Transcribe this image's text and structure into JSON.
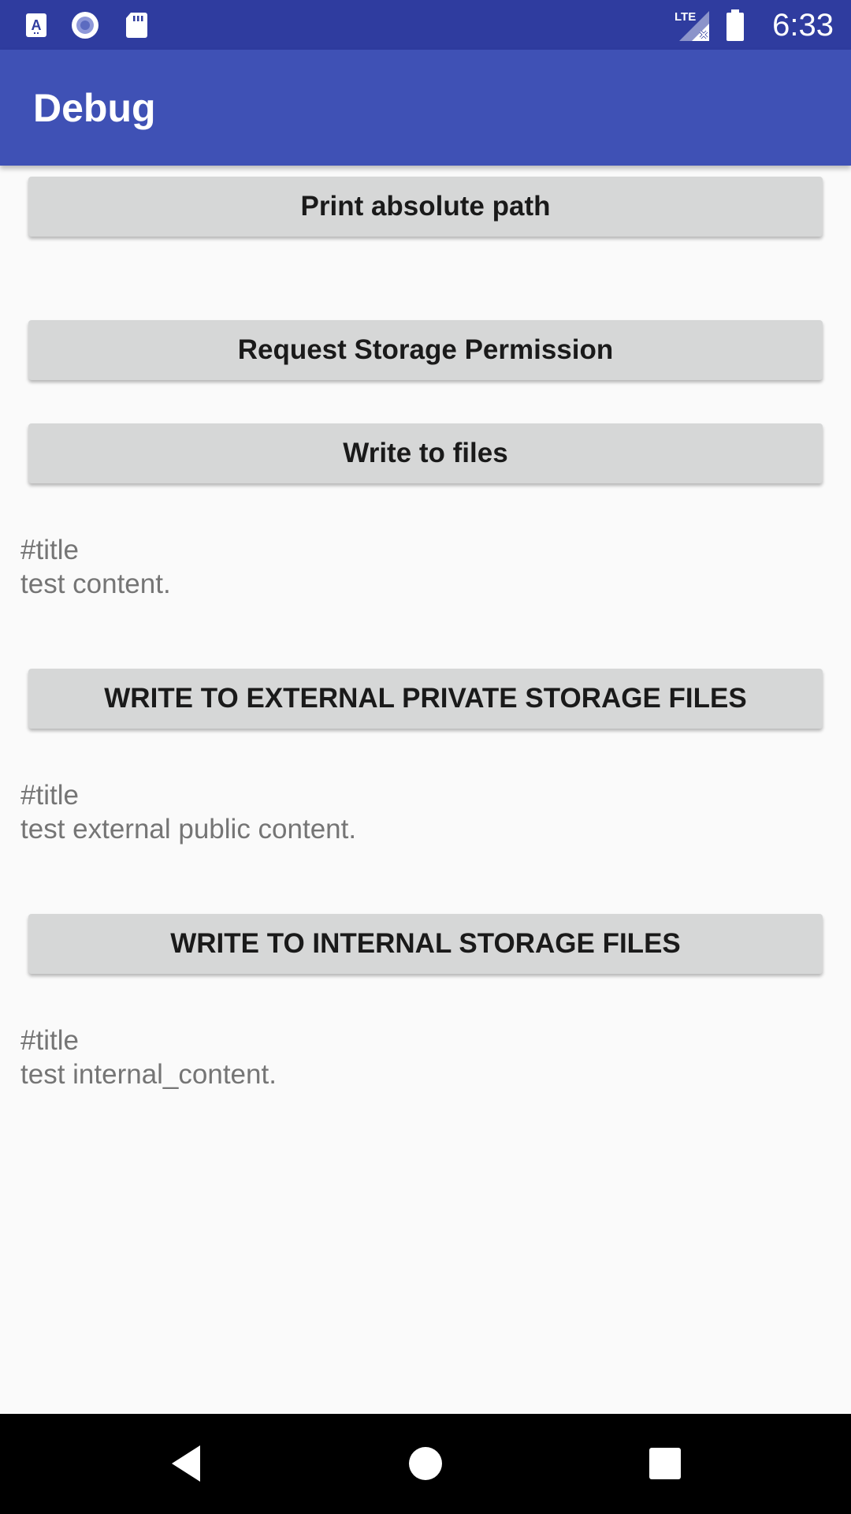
{
  "status_bar": {
    "time": "6:33",
    "network": "LTE",
    "left_icons": [
      "a-notification-icon",
      "circle-notification-icon",
      "sd-card-icon"
    ],
    "right_icons": [
      "lte-signal-icon",
      "battery-icon"
    ]
  },
  "app_bar": {
    "title": "Debug",
    "color": "#3f51b5",
    "status_color": "#2f3c9f"
  },
  "main": {
    "buttons": {
      "print_path": "Print absolute path",
      "request_permission": "Request Storage Permission",
      "write_files": "Write to files",
      "write_external_private": "WRITE TO EXTERNAL PRIVATE STORAGE FILES",
      "write_internal": "WRITE TO INTERNAL STORAGE FILES"
    },
    "outputs": [
      {
        "title": "#title",
        "content": "test content."
      },
      {
        "title": "#title",
        "content": "test external public content."
      },
      {
        "title": "#title",
        "content": "test internal_content."
      }
    ]
  },
  "nav_bar": {
    "icons": [
      "back-icon",
      "home-icon",
      "recents-icon"
    ]
  }
}
